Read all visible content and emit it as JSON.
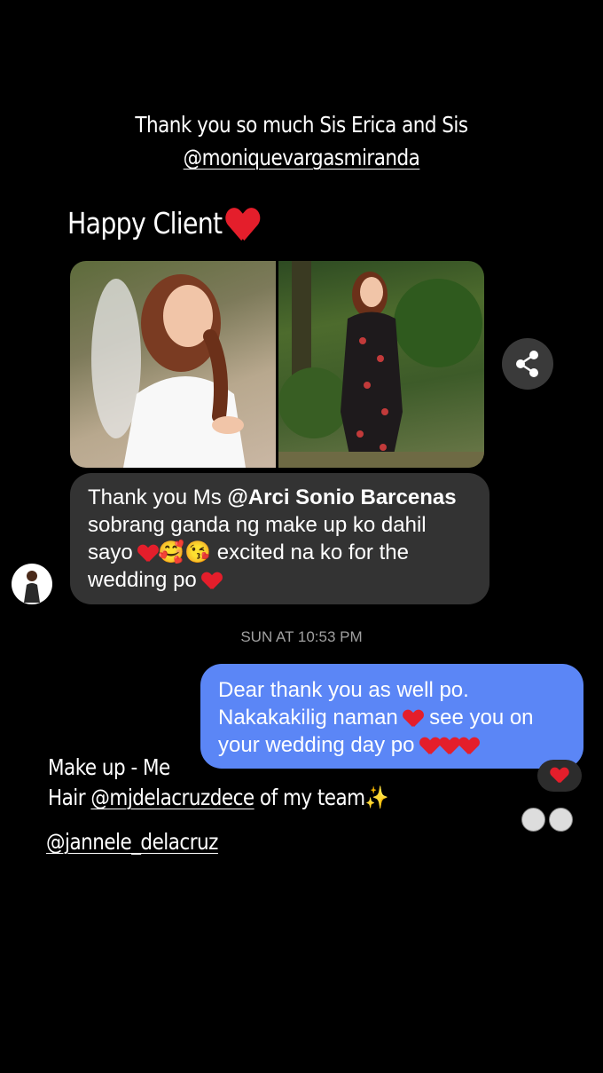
{
  "story": {
    "caption_line1": "Thank you so much Sis Erica and Sis",
    "caption_mention": "@moniquevargasmiranda",
    "heading": "Happy Client",
    "credits_line1": "Make up - Me",
    "credits_prefix": "Hair ",
    "credits_mention": "@mjdelacruzdece",
    "credits_suffix": " of my team",
    "credits_sparkle": "✨",
    "tag": "@jannele_delacruz"
  },
  "chat": {
    "incoming": {
      "part1": "Thank you Ms ",
      "mention": "@Arci Sonio Barcenas",
      "part2": " sobrang ganda ng make up ko dahil sayo ",
      "emoji": "🥰😘",
      "part3": " excited na ko for the wedding po "
    },
    "timestamp": "SUN AT 10:53 PM",
    "outgoing": {
      "part1": "Dear thank you as well po. Nakakakilig naman ",
      "part2": " see you on your wedding day po "
    }
  },
  "colors": {
    "background": "#000000",
    "incoming_bubble": "#333333",
    "outgoing_bubble": "#5b86f6",
    "heart": "#e41e2b"
  },
  "icons": {
    "share": "share-icon",
    "reaction": "heart-icon"
  }
}
